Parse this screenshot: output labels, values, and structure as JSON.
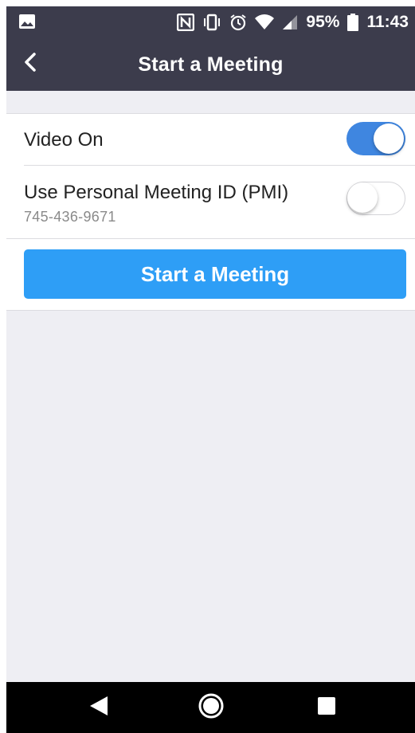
{
  "status_bar": {
    "battery": "95%",
    "time": "11:43",
    "icons": [
      "image-notification-icon",
      "nfc-icon",
      "vibrate-icon",
      "alarm-icon",
      "wifi-icon",
      "cell-signal-icon",
      "battery-icon"
    ]
  },
  "header": {
    "title": "Start a Meeting",
    "back_icon": "chevron-left-icon"
  },
  "settings": {
    "video_on": {
      "label": "Video On",
      "enabled": true
    },
    "pmi": {
      "label": "Use Personal Meeting ID (PMI)",
      "meeting_id": "745-436-9671",
      "enabled": false
    }
  },
  "start_button": {
    "label": "Start a Meeting"
  },
  "system_nav": {
    "icons": [
      "back-triangle-icon",
      "home-circle-icon",
      "recents-square-icon"
    ]
  },
  "colors": {
    "header_bg": "#3c3c4c",
    "page_bg": "#eeeef3",
    "toggle_on": "#3f86e0",
    "button_blue": "#2e9ef6",
    "nav_bg": "#000000"
  }
}
